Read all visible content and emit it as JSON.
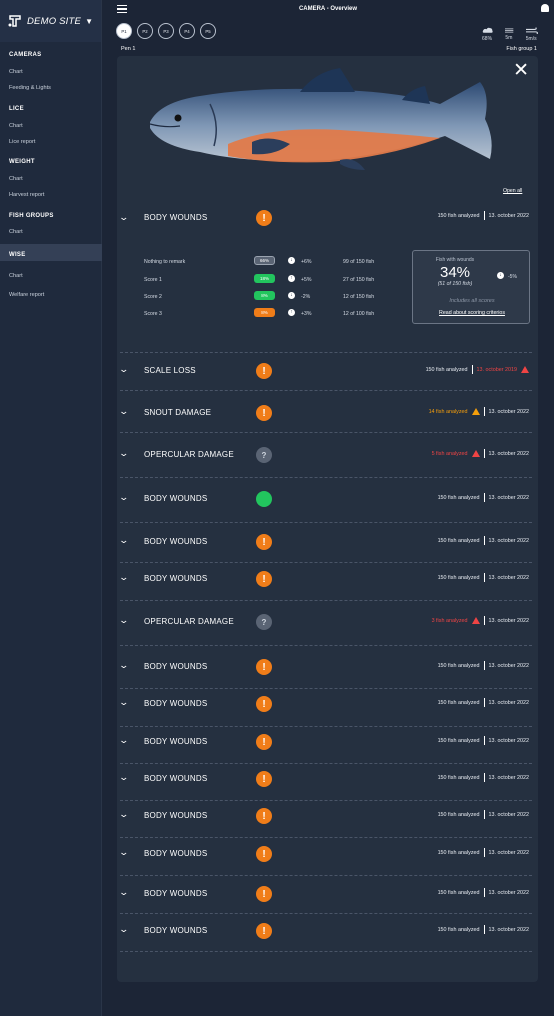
{
  "app": {
    "site_name": "DEMO SITE",
    "page_title": "CAMERA - Overview"
  },
  "sidebar": {
    "sections": [
      {
        "title": "CAMERAS",
        "items": [
          "Chart",
          "Feeding & Lights"
        ]
      },
      {
        "title": "LICE",
        "items": [
          "Chart",
          "Lice report"
        ]
      },
      {
        "title": "WEIGHT",
        "items": [
          "Chart",
          "Harvest report"
        ]
      },
      {
        "title": "FISH GROUPS",
        "items": [
          "Chart"
        ]
      },
      {
        "title": "WISE",
        "items": [
          "Chart",
          "Welfare report"
        ]
      }
    ]
  },
  "pens": [
    "P1",
    "P2",
    "P3",
    "P4",
    "P5"
  ],
  "active_pen": "P1",
  "weather": {
    "cloud": "68%",
    "waves": "5m",
    "wind": "5m/s"
  },
  "pen_label": "Pen 1",
  "fish_group_label": "Fish group 1",
  "open_all_label": "Open all",
  "expanded": {
    "title": "BODY WOUNDS",
    "analyzed": "150 fish analyzed",
    "date": "13. october 2022",
    "scores": [
      {
        "name": "Nothing to remark",
        "pill": "66%",
        "pill_color": "#5a6474",
        "direction": "down",
        "change": "+6%",
        "of": "99 of 150 fish"
      },
      {
        "name": "Score 1",
        "pill": "18%",
        "pill_color": "#22c55e",
        "direction": "up",
        "change": "+5%",
        "of": "27 of 150 fish"
      },
      {
        "name": "Score 2",
        "pill": "8%",
        "pill_color": "#22c55e",
        "direction": "down",
        "change": "-2%",
        "of": "12 of 150 fish"
      },
      {
        "name": "Score 3",
        "pill": "8%",
        "pill_color": "#f07d19",
        "direction": "up",
        "change": "+3%",
        "of": "12 of 100 fish"
      }
    ],
    "summary": {
      "title": "Fish with wounds",
      "percent": "34%",
      "sub": "(51 of 150 fish)",
      "change": "-5%",
      "includes": "Includes all scores",
      "link": "Read about scoring criterios"
    }
  },
  "rows": [
    {
      "label": "SCALE LOSS",
      "badge": "warn",
      "count": "150 fish analyzed",
      "count_color": "",
      "count_warn": "",
      "date": "13. october 2019",
      "date_color": "red",
      "date_warn": true
    },
    {
      "label": "SNOUT DAMAGE",
      "badge": "warn",
      "count": "14 fish analyzed",
      "count_color": "orange",
      "count_warn": "orange",
      "date": "13. october 2022",
      "date_color": "",
      "date_warn": false
    },
    {
      "label": "OPERCULAR DAMAGE",
      "badge": "unk",
      "count": "5 fish analyzed",
      "count_color": "red",
      "count_warn": "red",
      "date": "13. october 2022",
      "date_color": "",
      "date_warn": false
    },
    {
      "label": "BODY WOUNDS",
      "badge": "ok",
      "count": "150 fish analyzed",
      "count_color": "",
      "count_warn": "",
      "date": "13. october 2022",
      "date_color": "",
      "date_warn": false
    },
    {
      "label": "BODY WOUNDS",
      "badge": "warn",
      "count": "150 fish analyzed",
      "count_color": "",
      "count_warn": "",
      "date": "13. october 2022",
      "date_color": "",
      "date_warn": false
    },
    {
      "label": "BODY WOUNDS",
      "badge": "warn",
      "count": "150 fish analyzed",
      "count_color": "",
      "count_warn": "",
      "date": "13. october 2022",
      "date_color": "",
      "date_warn": false
    },
    {
      "label": "OPERCULAR DAMAGE",
      "badge": "unk",
      "count": "3 fish analyzed",
      "count_color": "red",
      "count_warn": "red",
      "date": "13. october 2022",
      "date_color": "",
      "date_warn": false
    },
    {
      "label": "BODY WOUNDS",
      "badge": "warn",
      "count": "150 fish analyzed",
      "count_color": "",
      "count_warn": "",
      "date": "13. october 2022",
      "date_color": "",
      "date_warn": false
    },
    {
      "label": "BODY WOUNDS",
      "badge": "warn",
      "count": "150 fish analyzed",
      "count_color": "",
      "count_warn": "",
      "date": "13. october 2022",
      "date_color": "",
      "date_warn": false
    },
    {
      "label": "BODY WOUNDS",
      "badge": "warn",
      "count": "150 fish analyzed",
      "count_color": "",
      "count_warn": "",
      "date": "13. october 2022",
      "date_color": "",
      "date_warn": false
    },
    {
      "label": "BODY WOUNDS",
      "badge": "warn",
      "count": "150 fish analyzed",
      "count_color": "",
      "count_warn": "",
      "date": "13. october 2022",
      "date_color": "",
      "date_warn": false
    },
    {
      "label": "BODY WOUNDS",
      "badge": "warn",
      "count": "150 fish analyzed",
      "count_color": "",
      "count_warn": "",
      "date": "13. october 2022",
      "date_color": "",
      "date_warn": false
    },
    {
      "label": "BODY WOUNDS",
      "badge": "warn",
      "count": "150 fish analyzed",
      "count_color": "",
      "count_warn": "",
      "date": "13. october 2022",
      "date_color": "",
      "date_warn": false
    },
    {
      "label": "BODY WOUNDS",
      "badge": "warn",
      "count": "150 fish analyzed",
      "count_color": "",
      "count_warn": "",
      "date": "13. october 2022",
      "date_color": "",
      "date_warn": false
    },
    {
      "label": "BODY WOUNDS",
      "badge": "warn",
      "count": "150 fish analyzed",
      "count_color": "",
      "count_warn": "",
      "date": "13. october 2022",
      "date_color": "",
      "date_warn": false
    }
  ],
  "colors": {
    "warn": "#f07d19",
    "ok": "#22c55e",
    "alert": "#ef4444",
    "background": "#1c2536"
  }
}
